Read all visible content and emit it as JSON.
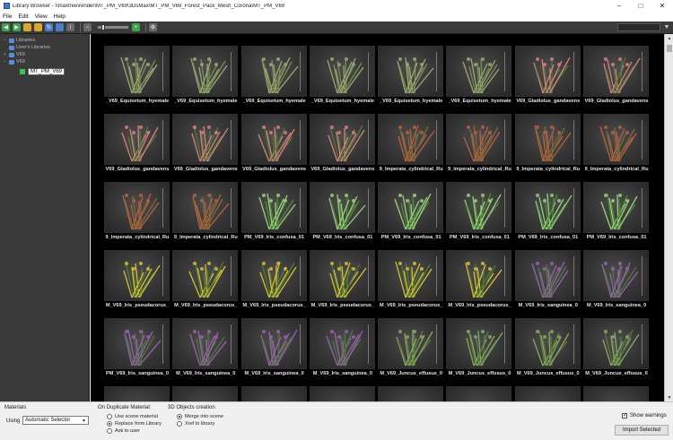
{
  "window": {
    "title": "Library Browser - \\\\maxtree\\render\\MT_PM_V69\\3DsMax\\MT_PM_V69_Forest_Pack_Mesh_Corona\\MT_PM_V69",
    "minimize": "–",
    "maximize": "□",
    "close": "✕"
  },
  "menu": [
    "File",
    "Edit",
    "View",
    "Help"
  ],
  "tree": {
    "root": "Libraries",
    "items": [
      "User's Libraries",
      "V69",
      "V69"
    ],
    "selected": "MT_PM_V69"
  },
  "tiles": [
    "_V69_Equisetum_hyemale",
    "_V69_Equisetum_hyemale",
    "_V69_Equisetum_hyemale",
    "_V69_Equisetum_hyemale",
    "_V69_Equisetum_hyemale",
    "_V69_Equisetum_hyemale",
    "V69_Gladiolus_gandavens",
    "V69_Gladiolus_gandavens",
    "V69_Gladiolus_gandavens",
    "V69_Gladiolus_gandavens",
    "V69_Gladiolus_gandavens",
    "V69_Gladiolus_gandavens",
    "9_Imperata_cylindrical_Ru",
    "9_Imperata_cylindrical_Ru",
    "9_Imperata_cylindrical_Ru",
    "9_Imperata_cylindrical_Ru",
    "9_Imperata_cylindrical_Ru",
    "9_Imperata_cylindrical_Ru",
    "PM_V69_Iris_confusa_01",
    "PM_V69_Iris_confusa_01",
    "PM_V69_Iris_confusa_01",
    "PM_V69_Iris_confusa_01",
    "PM_V69_Iris_confusa_01",
    "PM_V69_Iris_confusa_01",
    "M_V69_Iris_pseudacorus_",
    "M_V69_Iris_pseudacorus_",
    "M_V69_Iris_pseudacorus_",
    "M_V69_Iris_pseudacorus_",
    "M_V69_Iris_pseudacorus_",
    "M_V69_Iris_pseudacorus_",
    "M_V69_Iris_sanguinea_0",
    "M_V69_Iris_sanguinea_0",
    "PM_V69_Iris_sanguinea_0",
    "M_V69_Iris_sanguinea_0",
    "M_V69_Iris_sanguinea_0",
    "M_V69_Iris_sanguinea_0",
    "M_V69_Juncus_effusus_0",
    "M_V69_Juncus_effusus_0",
    "M_V69_Juncus_effusus_0",
    "M_V69_Juncus_effusus_0",
    "",
    "",
    "",
    "",
    "",
    "",
    "",
    ""
  ],
  "bottom": {
    "materials_title": "Materials",
    "using_label": "Using",
    "using_value": "Automatic Selector",
    "duplicate_title": "On Duplicate Material:",
    "dup_options": [
      "Use scene material",
      "Replace from Library",
      "Ask to user"
    ],
    "objects_title": "3D Objects creation",
    "obj_options": [
      "Merge into scene",
      "Xref to library"
    ],
    "show_warnings": "Show warnings",
    "import_button": "Import Selected"
  }
}
